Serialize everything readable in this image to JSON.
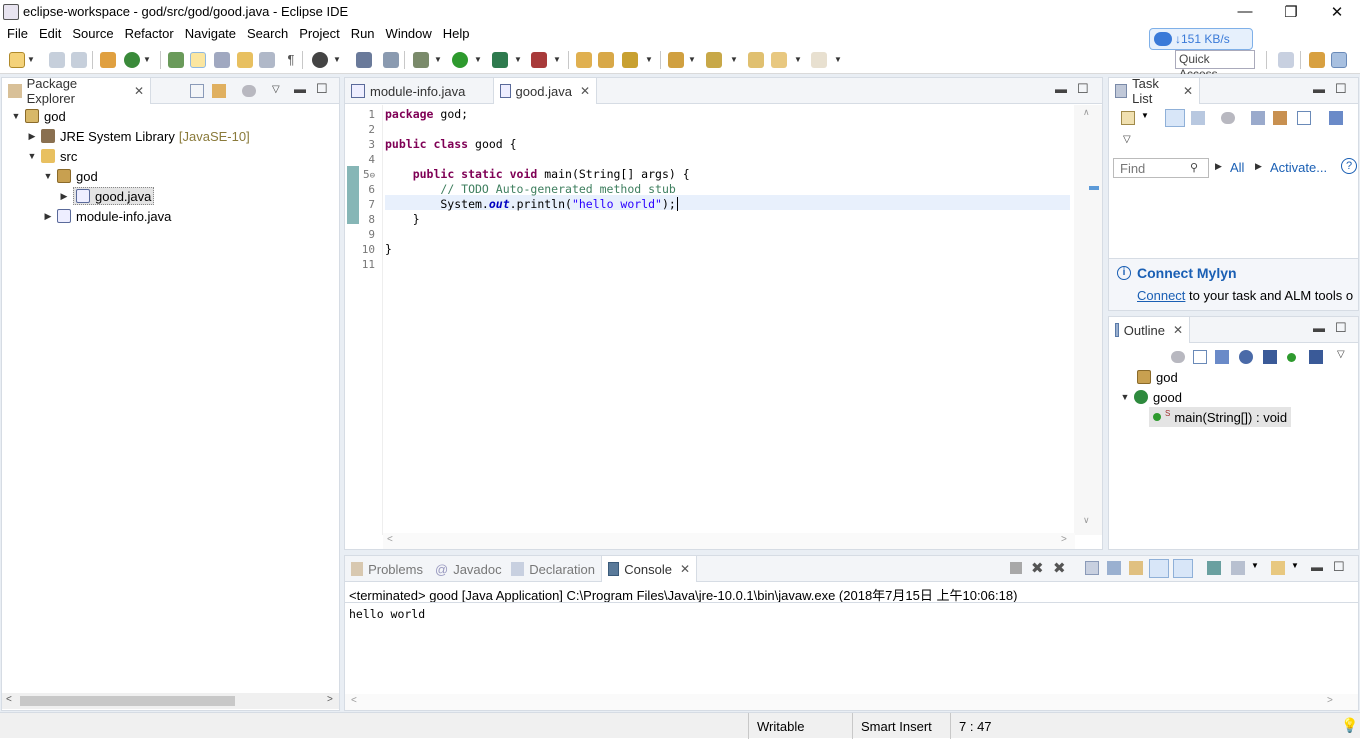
{
  "window": {
    "title": "eclipse-workspace - god/src/god/good.java - Eclipse IDE",
    "minimize": "—",
    "restore": "❐",
    "close": "✕"
  },
  "menu": [
    "File",
    "Edit",
    "Source",
    "Refactor",
    "Navigate",
    "Search",
    "Project",
    "Run",
    "Window",
    "Help"
  ],
  "net_speed": "↓151 KB/s",
  "quick_access": "Quick Access",
  "package_explorer": {
    "tab": "Package Explorer",
    "tree": {
      "project": "god",
      "jre": "JRE System Library",
      "jre_version": "[JavaSE-10]",
      "src": "src",
      "pkg": "god",
      "file1": "good.java",
      "file2": "module-info.java"
    }
  },
  "editor": {
    "tabs": [
      "module-info.java",
      "good.java"
    ],
    "lines": [
      {
        "n": "1",
        "text": "package god;"
      },
      {
        "n": "2",
        "text": ""
      },
      {
        "n": "3",
        "text": "public class good {"
      },
      {
        "n": "4",
        "text": ""
      },
      {
        "n": "5",
        "text": "    public static void main(String[] args) {"
      },
      {
        "n": "6",
        "text": "        // TODO Auto-generated method stub"
      },
      {
        "n": "7",
        "text": "        System.out.println(\"hello world\");"
      },
      {
        "n": "8",
        "text": "    }"
      },
      {
        "n": "9",
        "text": ""
      },
      {
        "n": "10",
        "text": "}"
      },
      {
        "n": "11",
        "text": ""
      }
    ]
  },
  "task_list": {
    "tab": "Task List",
    "find_placeholder": "Find",
    "all": "All",
    "activate": "Activate...",
    "connect_title": "Connect Mylyn",
    "connect_link": "Connect",
    "connect_rest": " to your task and ALM tools o"
  },
  "outline": {
    "tab": "Outline",
    "pkg": "god",
    "cls": "good",
    "method": "main(String[]) : void"
  },
  "console": {
    "tabs": [
      "Problems",
      "Javadoc",
      "Declaration",
      "Console"
    ],
    "header": "<terminated> good [Java Application] C:\\Program Files\\Java\\jre-10.0.1\\bin\\javaw.exe (2018年7月15日 上午10:06:18)",
    "output": "hello world"
  },
  "status": {
    "writable": "Writable",
    "insert": "Smart Insert",
    "pos": "7 : 47"
  },
  "colors": {
    "keyword": "#7f0055",
    "comment": "#3f7f5f",
    "string": "#2a00ff",
    "accent": "#1a5fb4"
  }
}
